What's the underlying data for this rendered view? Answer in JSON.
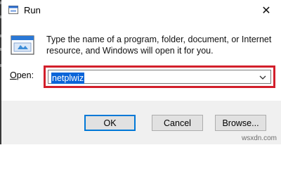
{
  "window": {
    "title": "Run",
    "app_icon": "run-app-icon",
    "close_glyph": "✕"
  },
  "dialog": {
    "run_icon": "run-icon",
    "description": "Type the name of a program, folder, document, or Internet resource, and Windows will open it for you.",
    "open_label_accel": "O",
    "open_label_rest": "pen:",
    "open_value": "netplwiz",
    "highlight_color": "#d21f2b"
  },
  "buttons": {
    "ok": "OK",
    "cancel": "Cancel",
    "browse": "Browse..."
  },
  "watermark": "wsxdn.com"
}
